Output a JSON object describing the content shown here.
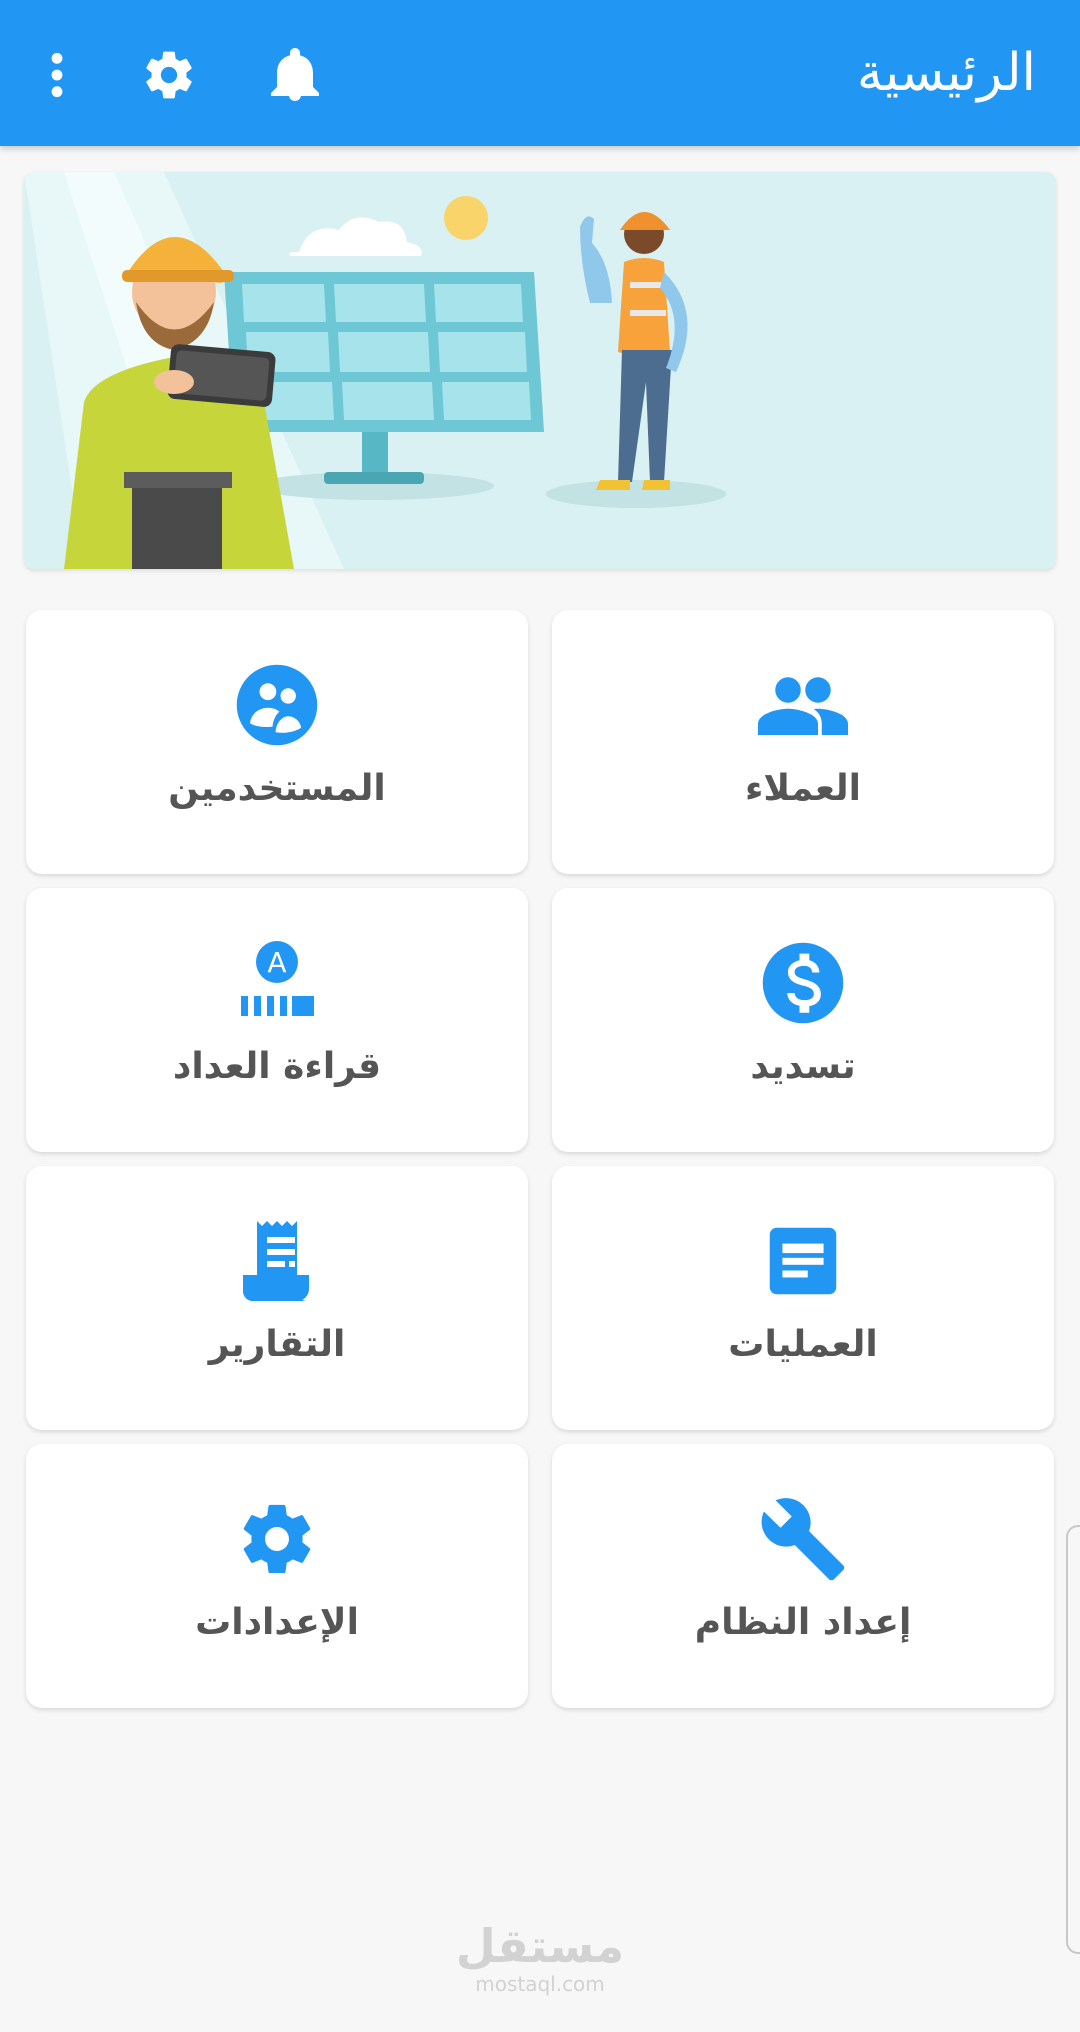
{
  "app_bar": {
    "title": "الرئيسية",
    "background_color": "#2196f3",
    "icons": [
      "notifications-icon",
      "settings-icon",
      "more-vert-icon"
    ]
  },
  "banner": {
    "illustration": "solar-panel-engineers"
  },
  "menu": {
    "accent_color": "#2196f3",
    "items": [
      {
        "label": "العملاء",
        "icon": "customers-icon"
      },
      {
        "label": "المستخدمين",
        "icon": "users-icon"
      },
      {
        "label": "تسديد",
        "icon": "dollar-icon"
      },
      {
        "label": "قراءة العداد",
        "icon": "meter-reading-icon"
      },
      {
        "label": "العمليات",
        "icon": "operations-icon"
      },
      {
        "label": "التقارير",
        "icon": "reports-icon"
      },
      {
        "label": "إعداد النظام",
        "icon": "wrench-icon"
      },
      {
        "label": "الإعدادات",
        "icon": "gear-icon"
      }
    ]
  },
  "watermark": {
    "arabic": "مستقل",
    "latin": "mostaql.com"
  }
}
